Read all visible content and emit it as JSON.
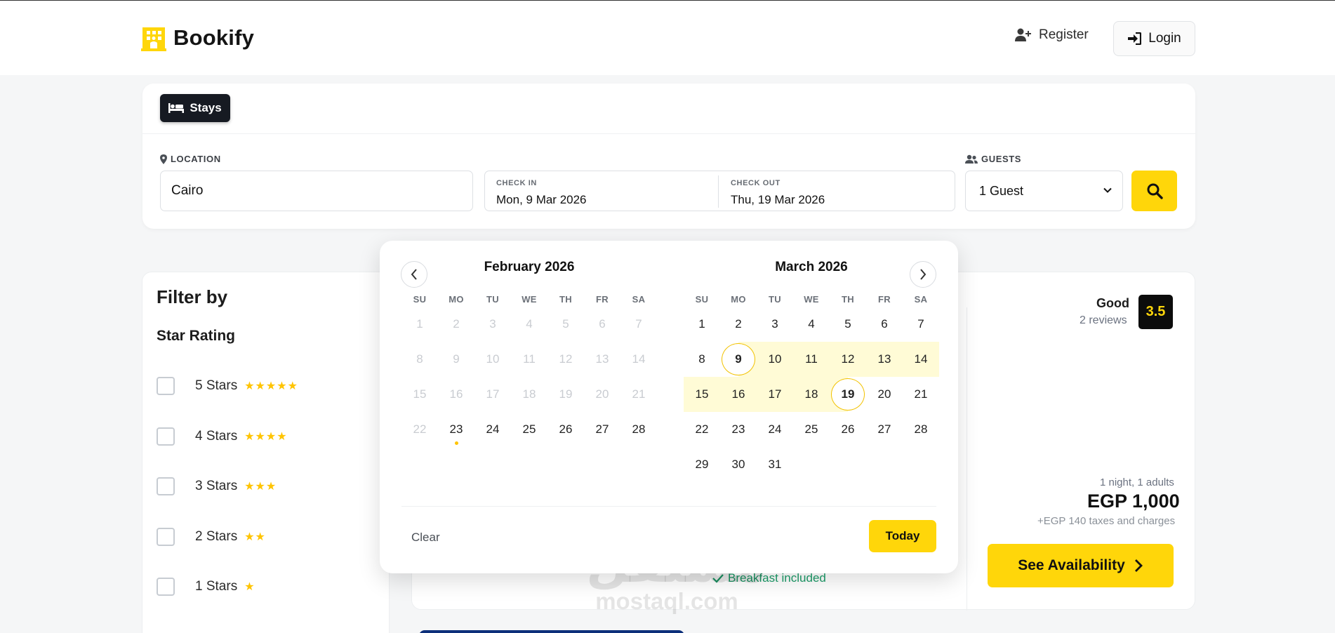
{
  "brand": {
    "name": "Bookify",
    "accent_color": "#ffd60a",
    "logo_icon": "hotel-building-icon"
  },
  "nav": {
    "register_label": "Register",
    "register_icon": "user-plus-icon",
    "login_label": "Login",
    "login_icon": "sign-in-icon"
  },
  "search": {
    "tab_label": "Stays",
    "tab_icon": "bed-icon",
    "location_label": "LOCATION",
    "location_value": "Cairo",
    "checkin_label": "CHECK IN",
    "checkin_value": "Mon, 9 Mar 2026",
    "checkout_label": "CHECK OUT",
    "checkout_value": "Thu, 19 Mar 2026",
    "guests_label": "GUESTS",
    "guests_value": "1 Guest",
    "search_icon": "magnifier-icon"
  },
  "filter": {
    "title": "Filter by",
    "section_title": "Star Rating",
    "options": [
      {
        "label": "5 Stars",
        "stars": 5
      },
      {
        "label": "4 Stars",
        "stars": 4
      },
      {
        "label": "3 Stars",
        "stars": 3
      },
      {
        "label": "2 Stars",
        "stars": 2
      },
      {
        "label": "1 Stars",
        "stars": 1
      }
    ]
  },
  "hotel": {
    "rating_word": "Good",
    "reviews": "2 reviews",
    "score": "3.5",
    "nights_info": "1 night, 1 adults",
    "price": "EGP 1,000",
    "taxes": "+EGP 140 taxes and charges",
    "availability_label": "See Availability",
    "breakfast": "Breakfast included"
  },
  "calendar": {
    "weekdays": [
      "SU",
      "MO",
      "TU",
      "WE",
      "TH",
      "FR",
      "SA"
    ],
    "months": [
      {
        "title": "February 2026",
        "weeks": [
          [
            {
              "d": "1",
              "m": 1
            },
            {
              "d": "2",
              "m": 1
            },
            {
              "d": "3",
              "m": 1
            },
            {
              "d": "4",
              "m": 1
            },
            {
              "d": "5",
              "m": 1
            },
            {
              "d": "6",
              "m": 1
            },
            {
              "d": "7",
              "m": 1
            }
          ],
          [
            {
              "d": "8",
              "m": 1
            },
            {
              "d": "9",
              "m": 1
            },
            {
              "d": "10",
              "m": 1
            },
            {
              "d": "11",
              "m": 1
            },
            {
              "d": "12",
              "m": 1
            },
            {
              "d": "13",
              "m": 1
            },
            {
              "d": "14",
              "m": 1
            }
          ],
          [
            {
              "d": "15",
              "m": 1
            },
            {
              "d": "16",
              "m": 1
            },
            {
              "d": "17",
              "m": 1
            },
            {
              "d": "18",
              "m": 1
            },
            {
              "d": "19",
              "m": 1
            },
            {
              "d": "20",
              "m": 1
            },
            {
              "d": "21",
              "m": 1
            }
          ],
          [
            {
              "d": "22",
              "m": 1
            },
            {
              "d": "23",
              "today": 1
            },
            {
              "d": "24"
            },
            {
              "d": "25"
            },
            {
              "d": "26"
            },
            {
              "d": "27"
            },
            {
              "d": "28"
            }
          ]
        ]
      },
      {
        "title": "March 2026",
        "weeks": [
          [
            {
              "d": "1"
            },
            {
              "d": "2"
            },
            {
              "d": "3"
            },
            {
              "d": "4"
            },
            {
              "d": "5"
            },
            {
              "d": "6"
            },
            {
              "d": "7"
            }
          ],
          [
            {
              "d": "8"
            },
            {
              "d": "9",
              "end": 1
            },
            {
              "d": "10",
              "r": 1
            },
            {
              "d": "11",
              "r": 1
            },
            {
              "d": "12",
              "r": 1
            },
            {
              "d": "13",
              "r": 1
            },
            {
              "d": "14",
              "r": 1
            }
          ],
          [
            {
              "d": "15",
              "r": 1
            },
            {
              "d": "16",
              "r": 1
            },
            {
              "d": "17",
              "r": 1
            },
            {
              "d": "18",
              "r": 1
            },
            {
              "d": "19",
              "end": 1
            },
            {
              "d": "20"
            },
            {
              "d": "21"
            }
          ],
          [
            {
              "d": "22"
            },
            {
              "d": "23"
            },
            {
              "d": "24"
            },
            {
              "d": "25"
            },
            {
              "d": "26"
            },
            {
              "d": "27"
            },
            {
              "d": "28"
            }
          ],
          [
            {
              "d": "29"
            },
            {
              "d": "30"
            },
            {
              "d": "31"
            }
          ]
        ]
      }
    ],
    "clear_label": "Clear",
    "today_label": "Today",
    "prev_icon": "chevron-left-icon",
    "next_icon": "chevron-right-icon",
    "range_color": "#fffbd6"
  },
  "watermark": {
    "arabic": "مستقل",
    "latin": "mostaql.com"
  }
}
